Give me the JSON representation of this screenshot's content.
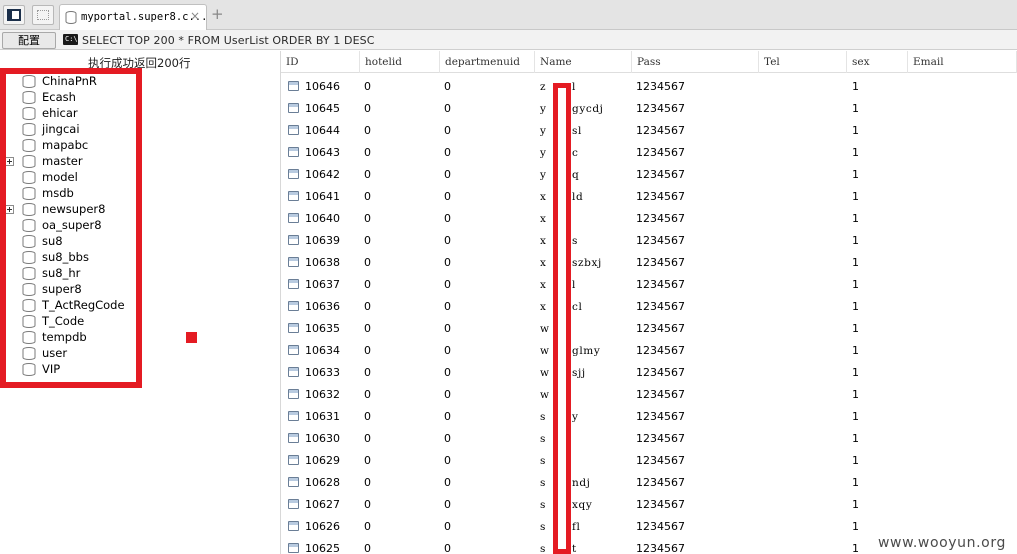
{
  "tab": {
    "label": "myportal.super8.c...",
    "close": "×",
    "new_tab": "+"
  },
  "toolbar": {
    "config_label": "配置",
    "terminal_icon": "C:\\",
    "sql": "SELECT TOP 200 * FROM UserList ORDER BY 1 DESC"
  },
  "status": "执行成功返回200行",
  "databases": [
    {
      "name": "ChinaPnR",
      "expandable": false
    },
    {
      "name": "Ecash",
      "expandable": false
    },
    {
      "name": "ehicar",
      "expandable": false
    },
    {
      "name": "jingcai",
      "expandable": false
    },
    {
      "name": "mapabc",
      "expandable": false
    },
    {
      "name": "master",
      "expandable": true
    },
    {
      "name": "model",
      "expandable": false
    },
    {
      "name": "msdb",
      "expandable": false
    },
    {
      "name": "newsuper8",
      "expandable": true
    },
    {
      "name": "oa_super8",
      "expandable": false
    },
    {
      "name": "su8",
      "expandable": false
    },
    {
      "name": "su8_bbs",
      "expandable": false
    },
    {
      "name": "su8_hr",
      "expandable": false
    },
    {
      "name": "super8",
      "expandable": false
    },
    {
      "name": "T_ActRegCode",
      "expandable": false
    },
    {
      "name": "T_Code",
      "expandable": false
    },
    {
      "name": "tempdb",
      "expandable": false
    },
    {
      "name": "user",
      "expandable": false
    },
    {
      "name": "VIP",
      "expandable": false
    }
  ],
  "grid": {
    "columns": [
      "ID",
      "hotelid",
      "departmenuid",
      "Name",
      "Pass",
      "Tel",
      "sex",
      "Email"
    ],
    "rows": [
      {
        "id": "10646",
        "hotelid": "0",
        "dept": "0",
        "name_l": "z",
        "name_r": "l",
        "pass": "1234567",
        "tel": "",
        "sex": "1",
        "email": ""
      },
      {
        "id": "10645",
        "hotelid": "0",
        "dept": "0",
        "name_l": "y",
        "name_r": "gycdj",
        "pass": "1234567",
        "tel": "",
        "sex": "1",
        "email": ""
      },
      {
        "id": "10644",
        "hotelid": "0",
        "dept": "0",
        "name_l": "y",
        "name_r": "sl",
        "pass": "1234567",
        "tel": "",
        "sex": "1",
        "email": ""
      },
      {
        "id": "10643",
        "hotelid": "0",
        "dept": "0",
        "name_l": "y",
        "name_r": "c",
        "pass": "1234567",
        "tel": "",
        "sex": "1",
        "email": ""
      },
      {
        "id": "10642",
        "hotelid": "0",
        "dept": "0",
        "name_l": "y",
        "name_r": "q",
        "pass": "1234567",
        "tel": "",
        "sex": "1",
        "email": ""
      },
      {
        "id": "10641",
        "hotelid": "0",
        "dept": "0",
        "name_l": "x",
        "name_r": "ld",
        "pass": "1234567",
        "tel": "",
        "sex": "1",
        "email": ""
      },
      {
        "id": "10640",
        "hotelid": "0",
        "dept": "0",
        "name_l": "x",
        "name_r": "",
        "pass": "1234567",
        "tel": "",
        "sex": "1",
        "email": ""
      },
      {
        "id": "10639",
        "hotelid": "0",
        "dept": "0",
        "name_l": "x",
        "name_r": "s",
        "pass": "1234567",
        "tel": "",
        "sex": "1",
        "email": ""
      },
      {
        "id": "10638",
        "hotelid": "0",
        "dept": "0",
        "name_l": "x",
        "name_r": "szbxj",
        "pass": "1234567",
        "tel": "",
        "sex": "1",
        "email": ""
      },
      {
        "id": "10637",
        "hotelid": "0",
        "dept": "0",
        "name_l": "x",
        "name_r": "l",
        "pass": "1234567",
        "tel": "",
        "sex": "1",
        "email": ""
      },
      {
        "id": "10636",
        "hotelid": "0",
        "dept": "0",
        "name_l": "x",
        "name_r": "cl",
        "pass": "1234567",
        "tel": "",
        "sex": "1",
        "email": ""
      },
      {
        "id": "10635",
        "hotelid": "0",
        "dept": "0",
        "name_l": "w",
        "name_r": "",
        "pass": "1234567",
        "tel": "",
        "sex": "1",
        "email": ""
      },
      {
        "id": "10634",
        "hotelid": "0",
        "dept": "0",
        "name_l": "w",
        "name_r": "glmy",
        "pass": "1234567",
        "tel": "",
        "sex": "1",
        "email": ""
      },
      {
        "id": "10633",
        "hotelid": "0",
        "dept": "0",
        "name_l": "w",
        "name_r": "sjj",
        "pass": "1234567",
        "tel": "",
        "sex": "1",
        "email": ""
      },
      {
        "id": "10632",
        "hotelid": "0",
        "dept": "0",
        "name_l": "w",
        "name_r": "",
        "pass": "1234567",
        "tel": "",
        "sex": "1",
        "email": ""
      },
      {
        "id": "10631",
        "hotelid": "0",
        "dept": "0",
        "name_l": "s",
        "name_r": "y",
        "pass": "1234567",
        "tel": "",
        "sex": "1",
        "email": ""
      },
      {
        "id": "10630",
        "hotelid": "0",
        "dept": "0",
        "name_l": "s",
        "name_r": "",
        "pass": "1234567",
        "tel": "",
        "sex": "1",
        "email": ""
      },
      {
        "id": "10629",
        "hotelid": "0",
        "dept": "0",
        "name_l": "s",
        "name_r": "",
        "pass": "1234567",
        "tel": "",
        "sex": "1",
        "email": ""
      },
      {
        "id": "10628",
        "hotelid": "0",
        "dept": "0",
        "name_l": "s",
        "name_r": "ndj",
        "pass": "1234567",
        "tel": "",
        "sex": "1",
        "email": ""
      },
      {
        "id": "10627",
        "hotelid": "0",
        "dept": "0",
        "name_l": "s",
        "name_r": "xqy",
        "pass": "1234567",
        "tel": "",
        "sex": "1",
        "email": ""
      },
      {
        "id": "10626",
        "hotelid": "0",
        "dept": "0",
        "name_l": "s",
        "name_r": "fl",
        "pass": "1234567",
        "tel": "",
        "sex": "1",
        "email": ""
      },
      {
        "id": "10625",
        "hotelid": "0",
        "dept": "0",
        "name_l": "s",
        "name_r": "t",
        "pass": "1234567",
        "tel": "",
        "sex": "1",
        "email": ""
      }
    ]
  },
  "watermark": "www.wooyun.org",
  "colors": {
    "annotation_red": "#e41b23",
    "tab_bg": "#e4e4e4"
  }
}
